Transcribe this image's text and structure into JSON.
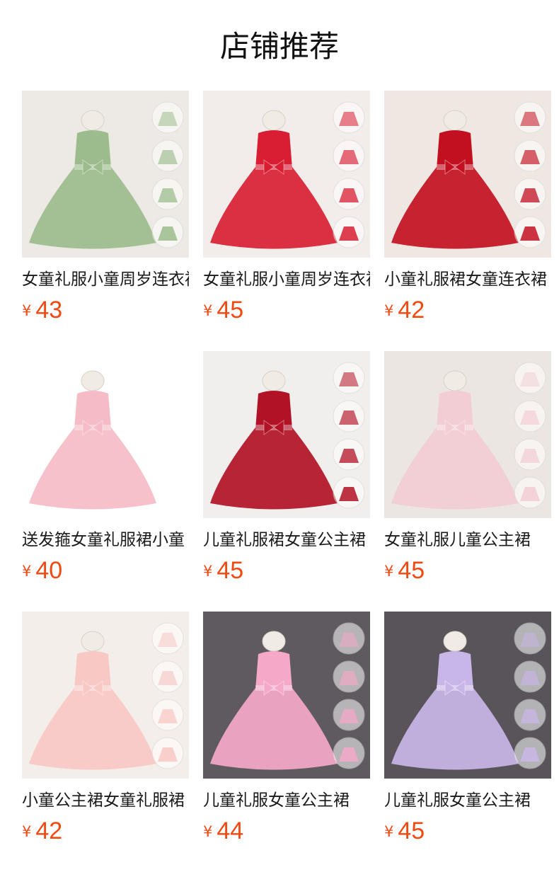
{
  "header": {
    "title": "店铺推荐"
  },
  "currency_symbol": "¥",
  "products": [
    {
      "name": "女童礼服小童周岁连衣裙",
      "price": "43",
      "color": "#9cbc8d",
      "bg": "#ede9e4"
    },
    {
      "name": "女童礼服小童周岁连衣裙",
      "price": "45",
      "color": "#d91e33",
      "bg": "#f2ecea"
    },
    {
      "name": "小童礼服裙女童连衣裙",
      "price": "42",
      "color": "#c31021",
      "bg": "#efe8e2"
    },
    {
      "name": "送发箍女童礼服裙小童",
      "price": "40",
      "color": "#f5bcc6",
      "bg": "#ffffff"
    },
    {
      "name": "儿童礼服裙女童公主裙",
      "price": "45",
      "color": "#b21225",
      "bg": "#f1efed"
    },
    {
      "name": "女童礼服儿童公主裙",
      "price": "45",
      "color": "#f2cdd3",
      "bg": "#ebe6e1"
    },
    {
      "name": "小童公主裙女童礼服裙",
      "price": "42",
      "color": "#f8c8c4",
      "bg": "#f4eeea"
    },
    {
      "name": "儿童礼服女童公主裙",
      "price": "44",
      "color": "#f5a8c8",
      "bg": "#5f5a5f"
    },
    {
      "name": "儿童礼服女童公主裙",
      "price": "45",
      "color": "#c9b6e8",
      "bg": "#58545a"
    }
  ]
}
